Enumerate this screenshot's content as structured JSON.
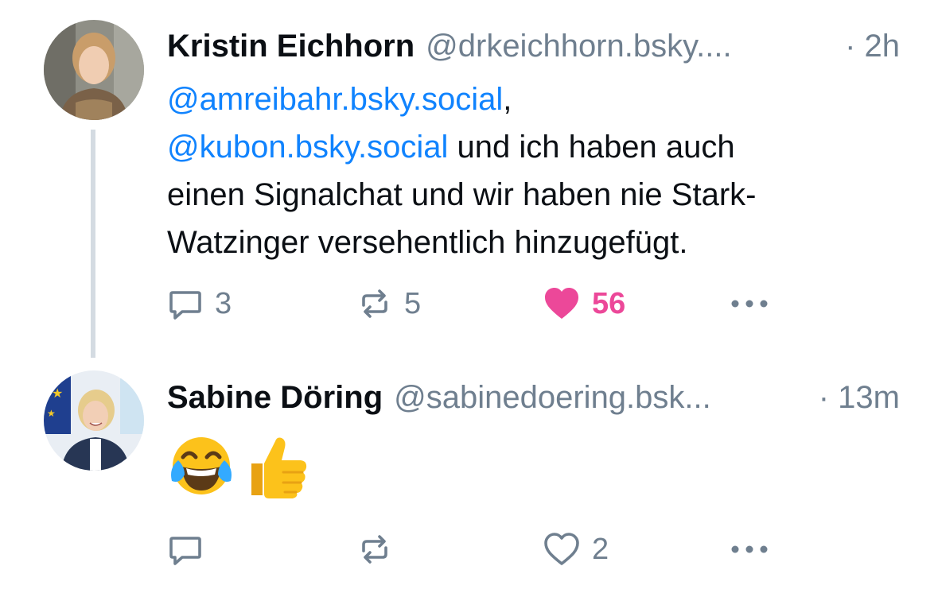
{
  "posts": [
    {
      "author": "Kristin Eichhorn",
      "handle": "@drkeichhorn.bsky....",
      "time": "· 2h",
      "mention1": "@amreibahr.bsky.social",
      "sep1": ",",
      "mention2": "@kubon.bsky.social",
      "text1": " und ich haben auch",
      "text2": "einen Signalchat und wir haben nie Stark-",
      "text3": "Watzinger versehentlich hinzugefügt.",
      "replies": "3",
      "reposts": "5",
      "likes": "56",
      "liked": true
    },
    {
      "author": "Sabine Döring",
      "handle": "@sabinedoering.bsk...",
      "time": "· 13m",
      "emojis": [
        "face-with-tears-of-joy",
        "thumbs-up"
      ],
      "replies": "",
      "reposts": "",
      "likes": "2",
      "liked": false
    }
  ],
  "colors": {
    "mention": "#1083fe",
    "muted": "#6f7f8f",
    "like": "#ec4899",
    "thread_line": "#d4dbe2"
  }
}
